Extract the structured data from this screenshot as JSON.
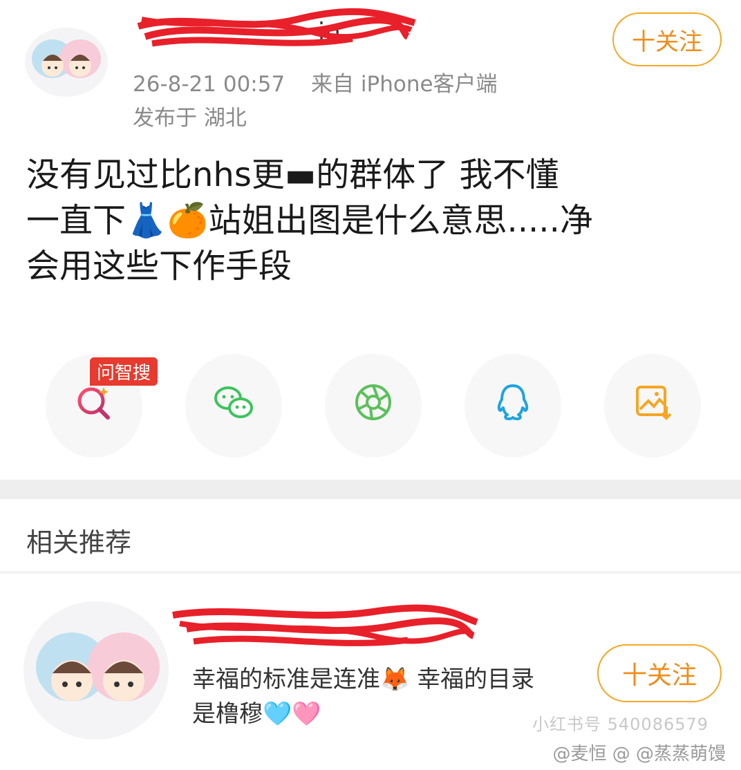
{
  "post": {
    "username_visible_tail": "in",
    "timestamp": "26-8-21 00:57",
    "source": "来自 iPhone客户端",
    "location": "发布于 湖北",
    "follow_label": "十关注",
    "content_lines": [
      "没有见过比nhs更▬的群体了 我不懂",
      "一直下👗🍊站姐出图是什么意思.....净",
      "会用这些下作手段"
    ]
  },
  "share": {
    "badge": "问智搜",
    "icons": [
      "search-ai-icon",
      "wechat-icon",
      "moments-icon",
      "qq-icon",
      "save-image-icon"
    ]
  },
  "related": {
    "title": "相关推荐",
    "item": {
      "bio_lines": [
        "幸福的标准是连准🦊 幸福的目录",
        "是橹穆🩵🩷"
      ],
      "follow_label": "十关注"
    }
  },
  "watermark": {
    "text": "小红书号 540086579",
    "credit": "@麦恒 @ @蒸蒸萌馒"
  },
  "colors": {
    "accent_orange": "#f08c1a",
    "badge_red": "#e63b2e",
    "wechat_green": "#3cc45b",
    "qq_blue": "#1fa3e0",
    "save_orange": "#f5a623"
  }
}
